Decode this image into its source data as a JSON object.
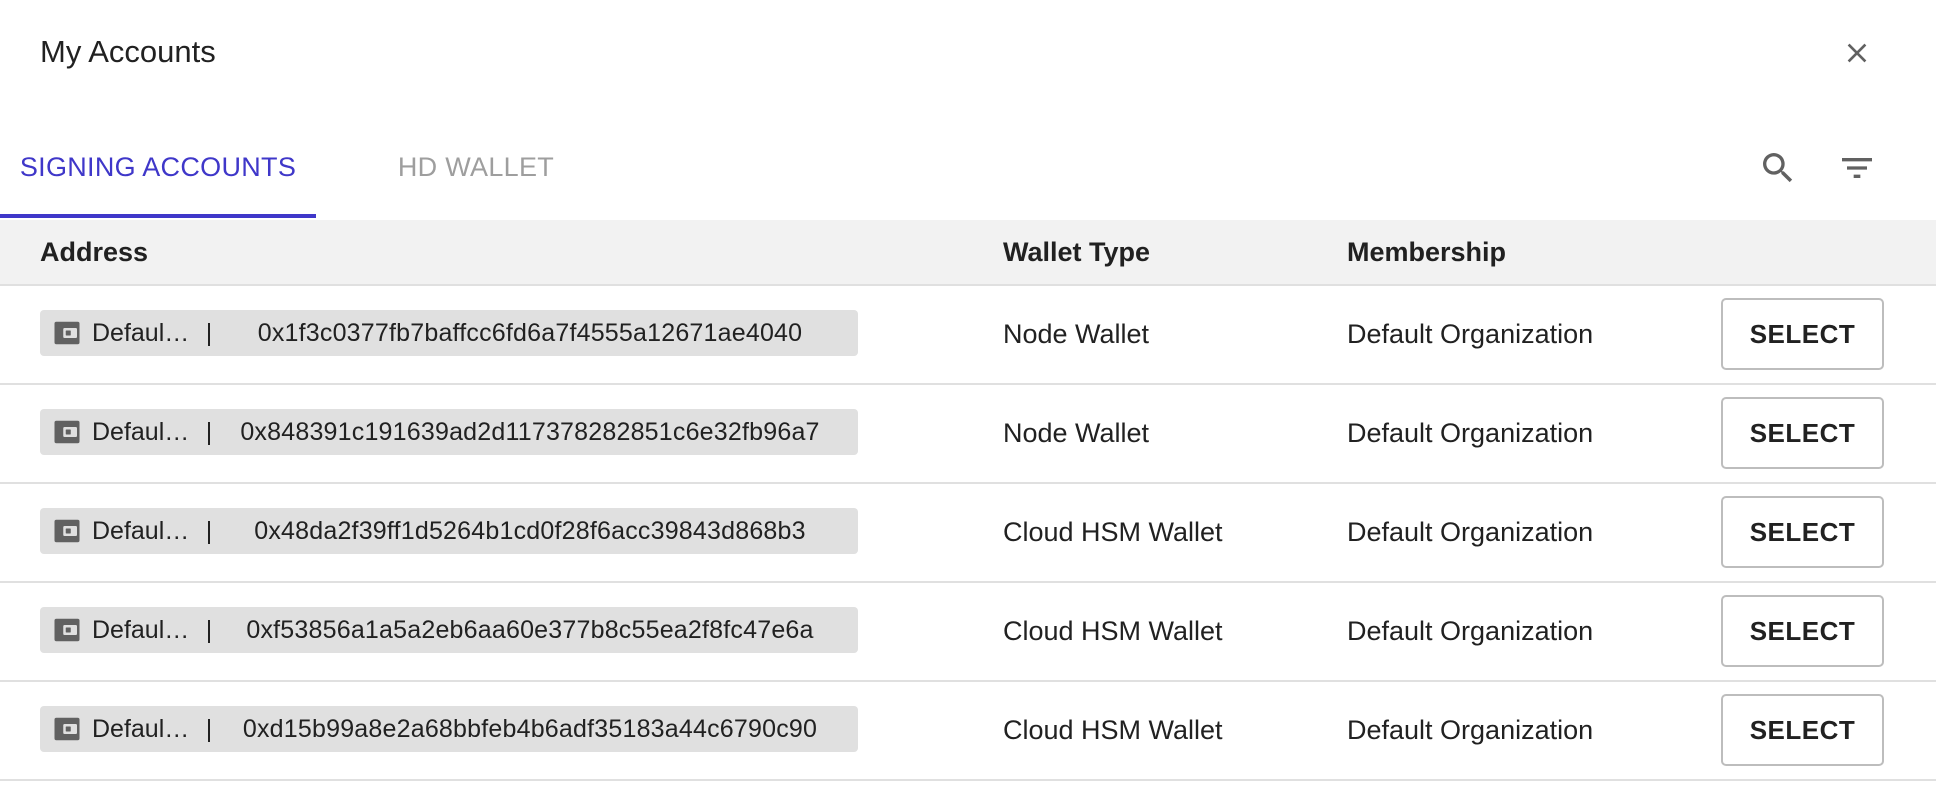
{
  "dialog": {
    "title": "My Accounts"
  },
  "tabs": [
    {
      "label": "SIGNING ACCOUNTS",
      "active": true
    },
    {
      "label": "HD WALLET",
      "active": false
    }
  ],
  "toolbar": {
    "search_icon": "search-icon",
    "filter_icon": "filter-icon"
  },
  "table": {
    "columns": [
      "Address",
      "Wallet Type",
      "Membership"
    ],
    "rows": [
      {
        "name": "Defaul…",
        "address": "0x1f3c0377fb7baffcc6fd6a7f4555a12671ae4040",
        "wallet_type": "Node Wallet",
        "membership": "Default Organization",
        "action": "SELECT"
      },
      {
        "name": "Defaul…",
        "address": "0x848391c191639ad2d117378282851c6e32fb96a7",
        "wallet_type": "Node Wallet",
        "membership": "Default Organization",
        "action": "SELECT"
      },
      {
        "name": "Defaul…",
        "address": "0x48da2f39ff1d5264b1cd0f28f6acc39843d868b3",
        "wallet_type": "Cloud HSM Wallet",
        "membership": "Default Organization",
        "action": "SELECT"
      },
      {
        "name": "Defaul…",
        "address": "0xf53856a1a5a2eb6aa60e377b8c55ea2f8fc47e6a",
        "wallet_type": "Cloud HSM Wallet",
        "membership": "Default Organization",
        "action": "SELECT"
      },
      {
        "name": "Defaul…",
        "address": "0xd15b99a8e2a68bbfeb4b6adf35183a44c6790c90",
        "wallet_type": "Cloud HSM Wallet",
        "membership": "Default Organization",
        "action": "SELECT"
      }
    ]
  },
  "colors": {
    "accent": "#3f37c9",
    "chip_background": "#e0e0e0",
    "header_background": "#f2f2f2"
  }
}
